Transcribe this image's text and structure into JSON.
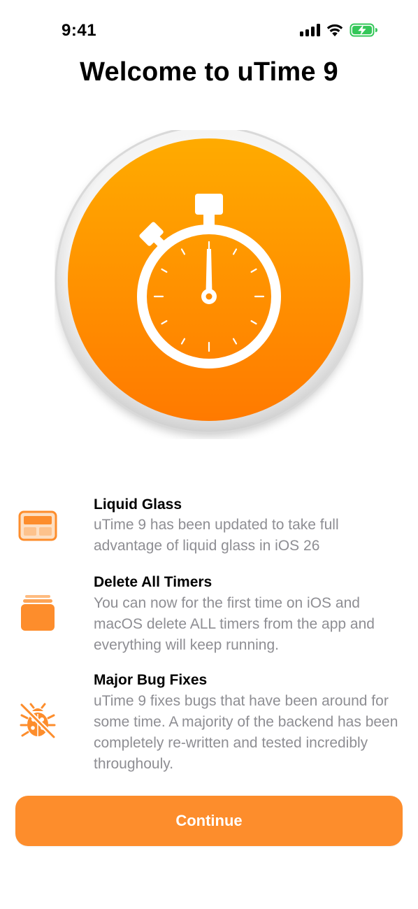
{
  "status_bar": {
    "time": "9:41",
    "icons": [
      "cellular-signal-icon",
      "wifi-icon",
      "battery-charging-icon"
    ],
    "battery_color": "#34c759"
  },
  "title": "Welcome to uTime 9",
  "app_icon": {
    "name": "stopwatch-app-icon",
    "colors": {
      "gradient_top": "#ffab00",
      "gradient_bottom": "#ff7a00",
      "ring": "#e2e2e2",
      "glyph": "#ffffff"
    }
  },
  "features": [
    {
      "icon": "liquid-glass-icon",
      "title": "Liquid Glass",
      "description": "uTime 9 has been updated to take full advantage of liquid glass in iOS 26"
    },
    {
      "icon": "stacked-cards-icon",
      "title": "Delete All Timers",
      "description": "You can now for the first time on iOS and macOS delete ALL timers from the app and everything will keep running."
    },
    {
      "icon": "ladybug-slash-icon",
      "title": "Major Bug Fixes",
      "description": "uTime 9 fixes bugs that have been around for some time. A majority of the backend has been completely re-written and tested incredibly throughouly."
    }
  ],
  "accent_color": "#fd8d2c",
  "continue_label": "Continue"
}
